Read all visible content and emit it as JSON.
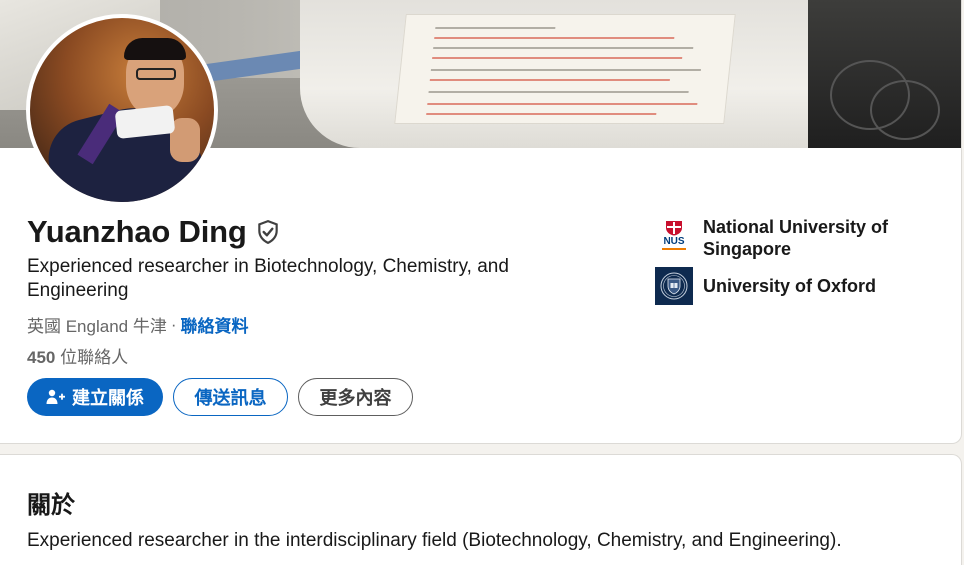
{
  "profile": {
    "name": "Yuanzhao Ding",
    "headline": "Experienced researcher in Biotechnology, Chemistry, and Engineering",
    "location": "英國 England 牛津",
    "location_separator": "·",
    "contact_info_label": "聯絡資料",
    "connections_count": "450",
    "connections_label": "位聯絡人"
  },
  "actions": {
    "connect_label": "建立關係",
    "message_label": "傳送訊息",
    "more_label": "更多內容"
  },
  "education": [
    {
      "name": "National University of Singapore",
      "logo_text": "NUS"
    },
    {
      "name": "University of Oxford"
    }
  ],
  "about": {
    "title": "關於",
    "text": "Experienced researcher in the interdisciplinary field (Biotechnology, Chemistry, and Engineering)."
  },
  "colors": {
    "brand_blue": "#0a66c2",
    "page_bg": "#f4f2ee",
    "oxford_navy": "#0e2a4f",
    "nus_orange": "#ef7c00",
    "nus_blue": "#003d7c"
  }
}
